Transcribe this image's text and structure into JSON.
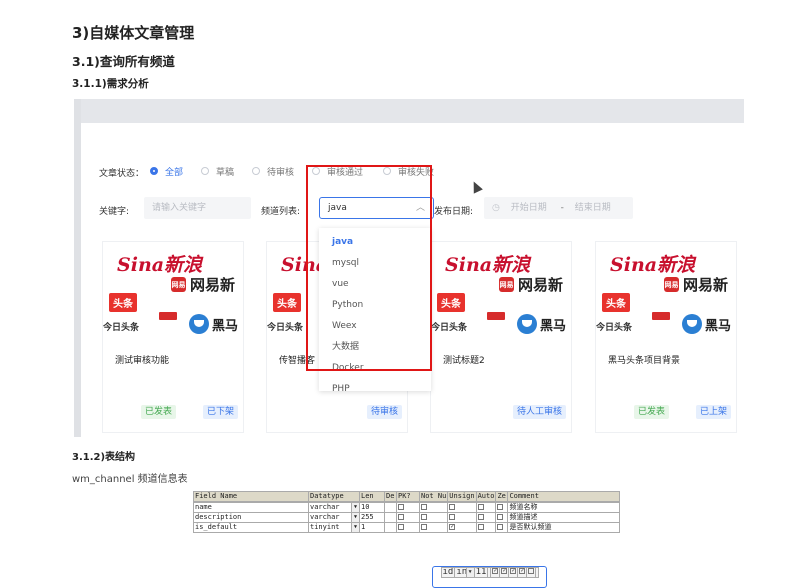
{
  "headings": {
    "h1": "3)自媒体文章管理",
    "h2": "3.1)查询所有频道",
    "h3": "3.1.1)需求分析",
    "h3b": "3.1.2)表结构",
    "table_desc": "wm_channel 频道信息表"
  },
  "filter": {
    "status_label": "文章状态：",
    "status_options": [
      "全部",
      "草稿",
      "待审核",
      "审核通过",
      "审核失败"
    ],
    "selected_status": "全部",
    "keyword_label": "关键字:",
    "keyword_placeholder": "请输入关键字",
    "channel_label": "频道列表:",
    "channel_value": "java",
    "date_label": "发布日期:",
    "date_start": "开始日期",
    "date_sep": "-",
    "date_end": "结束日期"
  },
  "dropdown": {
    "items": [
      "java",
      "mysql",
      "vue",
      "Python",
      "Weex",
      "大数据",
      "Docker",
      "PHP"
    ],
    "selected": "java"
  },
  "cards": [
    {
      "title": "测试审核功能",
      "badges": [
        {
          "label": "已发表",
          "style": "green"
        },
        {
          "label": "已下架",
          "style": "blue"
        }
      ]
    },
    {
      "title": "传智播客",
      "badges": [
        {
          "label": "待审核",
          "style": "blue"
        }
      ]
    },
    {
      "title": "测试标题2",
      "badges": [
        {
          "label": "待人工审核",
          "style": "blue"
        }
      ]
    },
    {
      "title": "黑马头条项目背景",
      "badges": [
        {
          "label": "已发表",
          "style": "green"
        },
        {
          "label": "已上架",
          "style": "blue"
        }
      ]
    }
  ],
  "logos": {
    "sina": "Sina新浪",
    "netease_box": "网易",
    "netease": "网易新",
    "toutiao": "头条",
    "jrtt": "今日头条",
    "heima": "黑马"
  },
  "table": {
    "headers": [
      "Field Name",
      "Datatype",
      "Len",
      "De",
      "PK?",
      "Not Nu",
      "Unsign",
      "Auto",
      "Ze",
      "Comment"
    ],
    "rows": [
      {
        "field": "id",
        "type": "int",
        "len": "11",
        "pk": true,
        "notnull": true,
        "unsigned": true,
        "auto": true,
        "ze": false,
        "comment": ""
      },
      {
        "field": "name",
        "type": "varchar",
        "len": "10",
        "pk": false,
        "notnull": false,
        "unsigned": false,
        "auto": false,
        "ze": false,
        "comment": "频道名称"
      },
      {
        "field": "description",
        "type": "varchar",
        "len": "255",
        "pk": false,
        "notnull": false,
        "unsigned": false,
        "auto": false,
        "ze": false,
        "comment": "频道描述"
      },
      {
        "field": "is_default",
        "type": "tinyint",
        "len": "1",
        "pk": false,
        "notnull": false,
        "unsigned": true,
        "auto": false,
        "ze": false,
        "comment": "是否默认频道"
      }
    ]
  },
  "colors": {
    "accent": "#3a75e8",
    "highlight_box": "#e01616",
    "green": "#43a850"
  }
}
